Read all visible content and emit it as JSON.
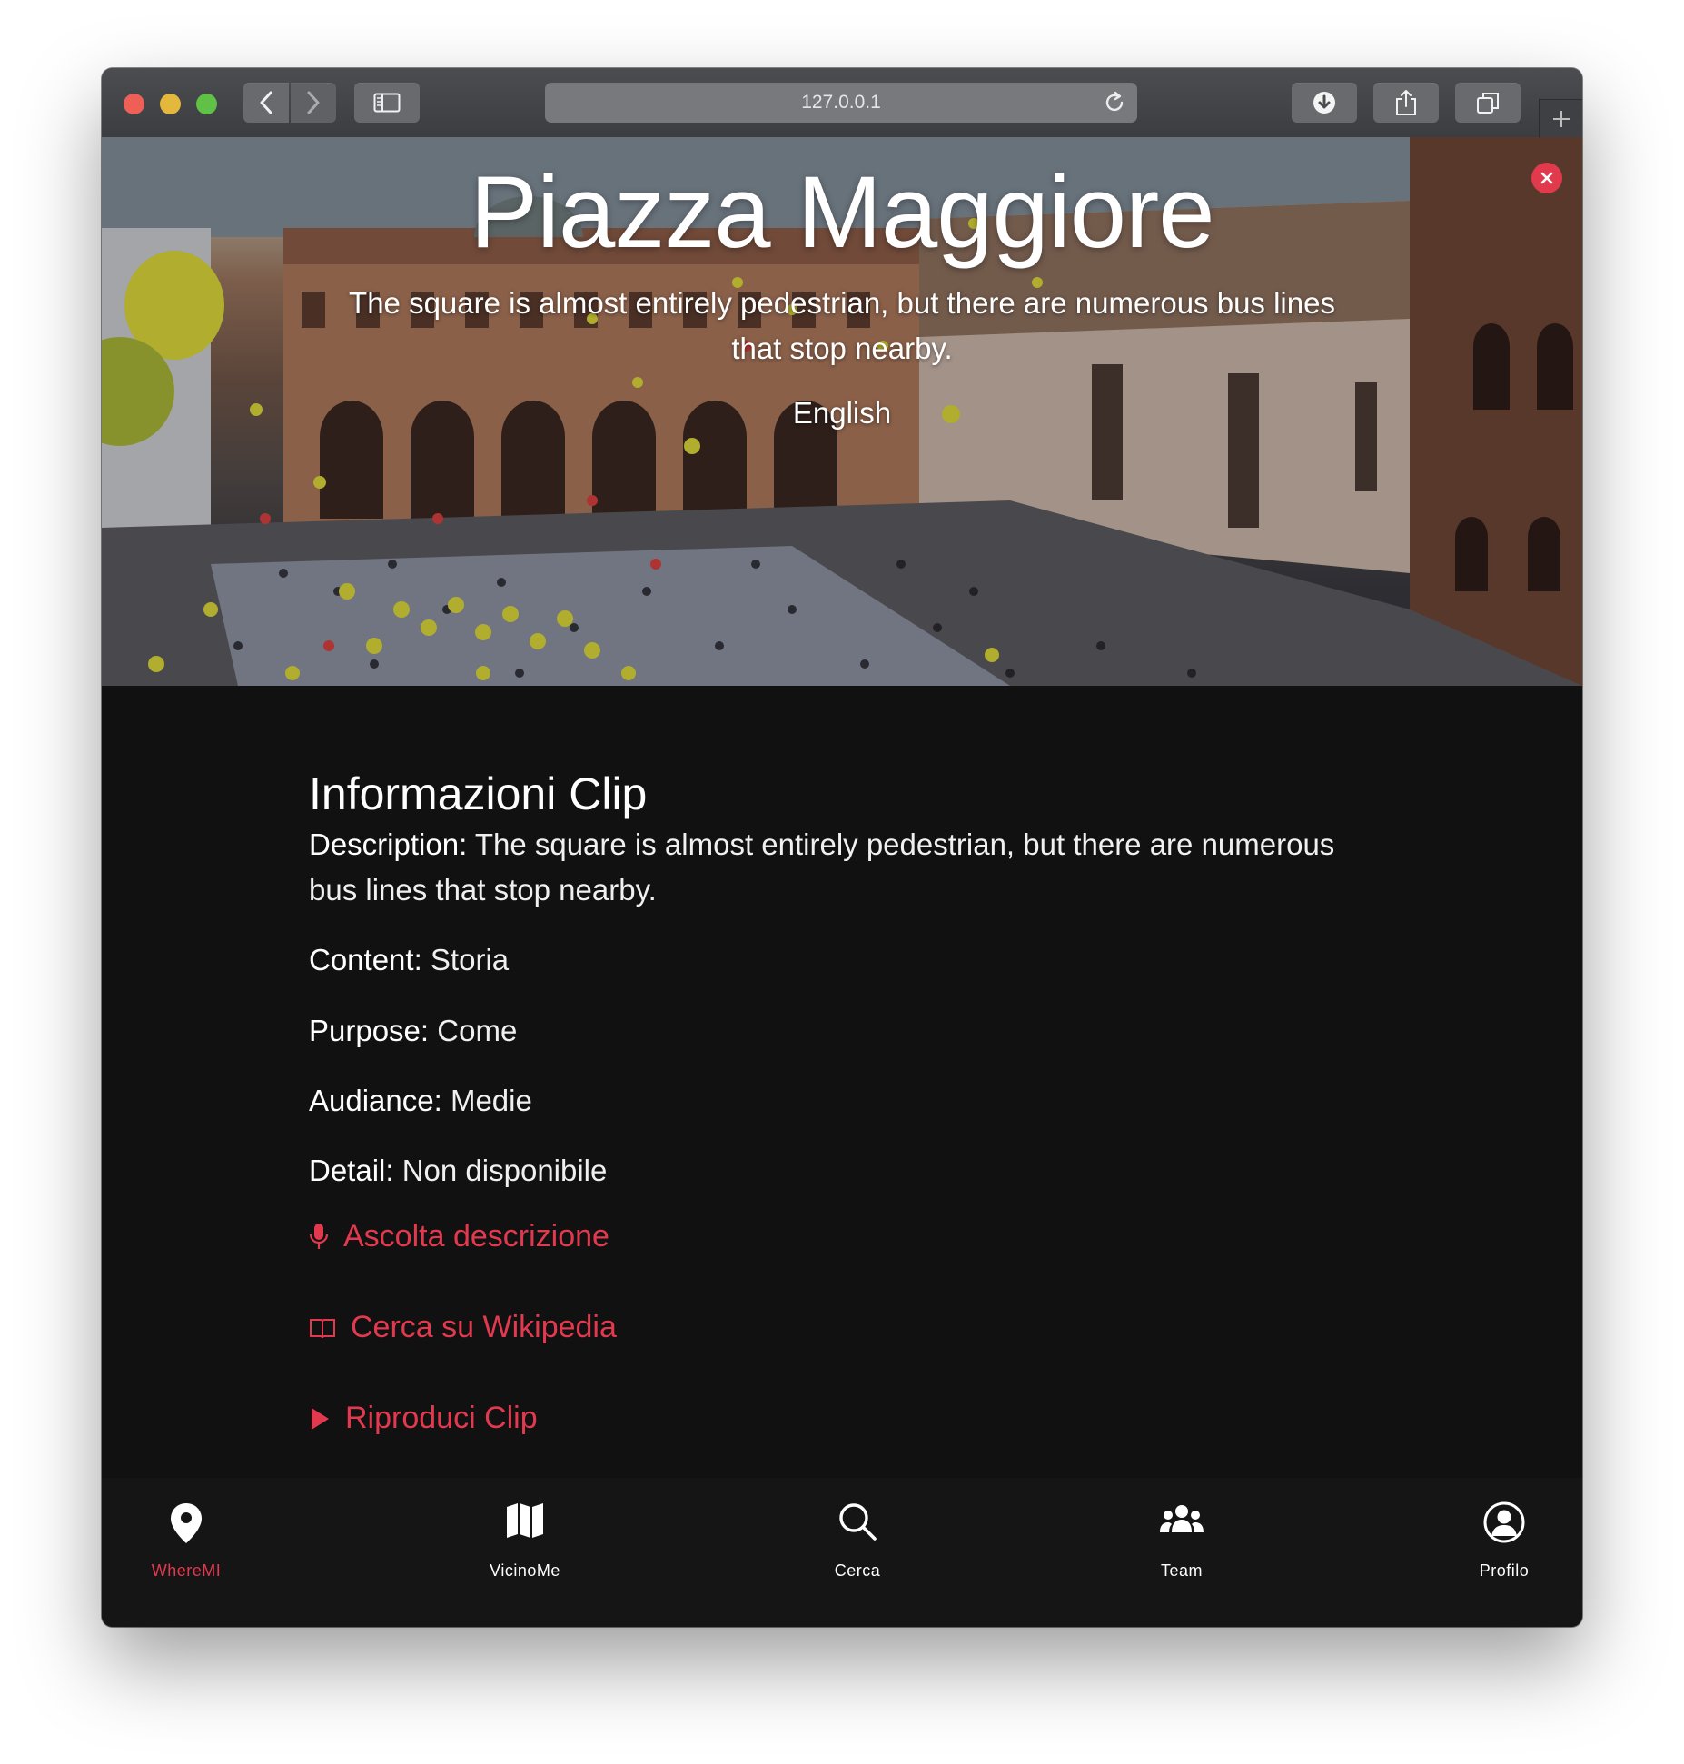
{
  "browser": {
    "address": "127.0.0.1"
  },
  "hero": {
    "title": "Piazza Maggiore",
    "subtitle": "The square is almost entirely pedestrian, but there are numerous bus lines that stop nearby.",
    "language": "English"
  },
  "info": {
    "heading": "Informazioni Clip",
    "description_label": "Description:",
    "description_value": "The square is almost entirely pedestrian, but there are numerous bus lines that stop nearby.",
    "content_label": "Content:",
    "content_value": "Storia",
    "purpose_label": "Purpose:",
    "purpose_value": "Come",
    "audience_label": "Audiance:",
    "audience_value": "Medie",
    "detail_label": "Detail:",
    "detail_value": "Non disponibile",
    "actions": {
      "listen": "Ascolta descrizione",
      "wikipedia": "Cerca su Wikipedia",
      "play": "Riproduci Clip"
    }
  },
  "bottom_nav": {
    "items": [
      {
        "label": "WhereMI",
        "icon": "map-pin-icon",
        "active": true
      },
      {
        "label": "VicinoMe",
        "icon": "map-icon",
        "active": false
      },
      {
        "label": "Cerca",
        "icon": "search-icon",
        "active": false
      },
      {
        "label": "Team",
        "icon": "team-icon",
        "active": false
      },
      {
        "label": "Profilo",
        "icon": "profile-icon",
        "active": false
      }
    ]
  },
  "colors": {
    "accent": "#e2394f",
    "background": "#111111",
    "nav_background": "#151516"
  }
}
